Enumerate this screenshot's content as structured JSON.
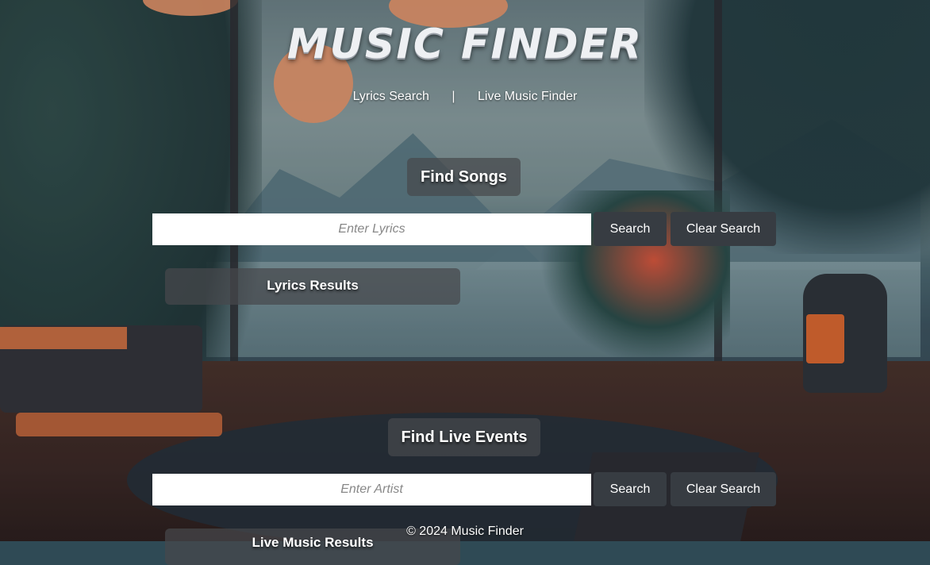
{
  "header": {
    "logo_text": "MUSIC FINDER"
  },
  "nav": {
    "lyrics_link": "Lyrics Search",
    "separator": "|",
    "live_link": "Live Music Finder"
  },
  "songs": {
    "heading": "Find Songs",
    "input_placeholder": "Enter Lyrics",
    "input_value": "",
    "search_label": "Search",
    "clear_label": "Clear Search",
    "results_heading": "Lyrics Results"
  },
  "events": {
    "heading": "Find Live Events",
    "input_placeholder": "Enter Artist",
    "input_value": "",
    "search_label": "Search",
    "clear_label": "Clear Search",
    "results_heading": "Live Music Results"
  },
  "footer": {
    "text": "© 2024 Music Finder"
  },
  "colors": {
    "button_bg": "#373c42",
    "panel_bg": "rgba(70,72,76,.72)",
    "text": "#ffffff"
  }
}
